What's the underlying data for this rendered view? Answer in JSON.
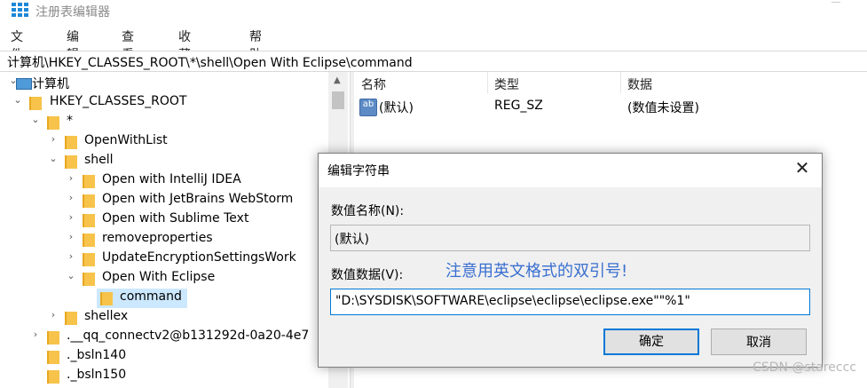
{
  "window": {
    "title": "注册表编辑器"
  },
  "menu": [
    "文件(F)",
    "编辑(E)",
    "查看(V)",
    "收藏夹(A)",
    "帮助(H)"
  ],
  "address": "计算机\\HKEY_CLASSES_ROOT\\*\\shell\\Open With Eclipse\\command",
  "tree": {
    "root": "计算机",
    "hkcr": "HKEY_CLASSES_ROOT",
    "star": "*",
    "openwithlist": "OpenWithList",
    "shell": "shell",
    "intellij": "Open with IntelliJ IDEA",
    "webstorm": "Open with JetBrains WebStorm",
    "sublime": "Open with Sublime Text",
    "removeprops": "removeproperties",
    "updateenc": "UpdateEncryptionSettingsWork",
    "eclipse": "Open With Eclipse",
    "command": "command",
    "shellex": "shellex",
    "qq": ".__qq_connectv2@b131292d-0a20-4e7",
    "bsln140": "._bsln140",
    "bsln150": "._bsln150"
  },
  "values": {
    "headers": {
      "name": "名称",
      "type": "类型",
      "data": "数据"
    },
    "row": {
      "name": "(默认)",
      "type": "REG_SZ",
      "data": "(数值未设置)",
      "icon": "ab"
    }
  },
  "dialog": {
    "title": "编辑字符串",
    "name_label": "数值名称(N):",
    "name_value": "(默认)",
    "data_label": "数值数据(V):",
    "note": "注意用英文格式的双引号!",
    "data_value": "\"D:\\SYSDISK\\SOFTWARE\\eclipse\\eclipse\\eclipse.exe\"\"%1\"",
    "ok": "确定",
    "cancel": "取消"
  },
  "watermark": "CSDN @stareccc",
  "colors": {
    "accent": "#0078d7",
    "selection": "#cce8ff",
    "folder": "#f7c34a",
    "note": "#3a6fd0"
  }
}
